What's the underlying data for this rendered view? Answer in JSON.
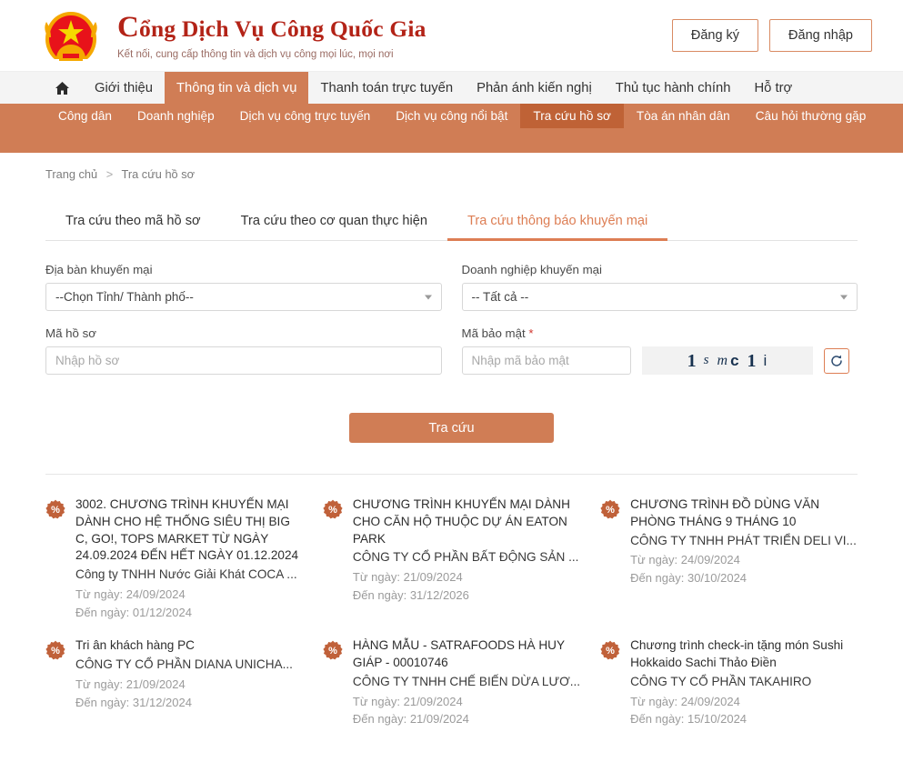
{
  "header": {
    "emblem_icon": "vietnam-national-emblem",
    "title_line": "Cổng Dịch Vụ Công Quốc Gia",
    "title_cap": "C",
    "title_rest": "ổng Dịch Vụ Công Quốc Gia",
    "subtitle": "Kết nối, cung cấp thông tin và dịch vụ công mọi lúc, mọi nơi",
    "register_label": "Đăng ký",
    "login_label": "Đăng nhập"
  },
  "nav": {
    "home_icon": "home-icon",
    "top_items": [
      {
        "label": "Giới thiệu",
        "active": false
      },
      {
        "label": "Thông tin và dịch vụ",
        "active": true
      },
      {
        "label": "Thanh toán trực tuyến",
        "active": false
      },
      {
        "label": "Phản ánh kiến nghị",
        "active": false
      },
      {
        "label": "Thủ tục hành chính",
        "active": false
      },
      {
        "label": "Hỗ trợ",
        "active": false
      }
    ],
    "sub_items": [
      {
        "label": "Công dân",
        "active": false
      },
      {
        "label": "Doanh nghiệp",
        "active": false
      },
      {
        "label": "Dịch vụ công trực tuyến",
        "active": false
      },
      {
        "label": "Dịch vụ công nổi bật",
        "active": false
      },
      {
        "label": "Tra cứu hồ sơ",
        "active": true
      },
      {
        "label": "Tòa án nhân dân",
        "active": false
      },
      {
        "label": "Câu hỏi thường gặp",
        "active": false
      }
    ]
  },
  "breadcrumb": {
    "home": "Trang chủ",
    "separator": ">",
    "current": "Tra cứu hồ sơ"
  },
  "tabs": [
    {
      "label": "Tra cứu theo mã hồ sơ",
      "active": false
    },
    {
      "label": "Tra cứu theo cơ quan thực hiện",
      "active": false
    },
    {
      "label": "Tra cứu thông báo khuyến mại",
      "active": true
    }
  ],
  "form": {
    "province": {
      "label": "Địa bàn khuyến mại",
      "value": "--Chọn Tỉnh/ Thành phố--"
    },
    "enterprise": {
      "label": "Doanh nghiệp khuyến mại",
      "value": "-- Tất cả --"
    },
    "dossier_code": {
      "label": "Mã hồ sơ",
      "value": "",
      "placeholder": "Nhập hồ sơ"
    },
    "captcha": {
      "label": "Mã bảo mật",
      "required_mark": "*",
      "value": "",
      "placeholder": "Nhập mã bảo mật",
      "code_chars": [
        "1",
        "s",
        "m",
        "c",
        "1",
        "i"
      ],
      "code_text": "1 s mc 1 i",
      "refresh_icon": "refresh-icon"
    },
    "submit_label": "Tra cứu"
  },
  "results": {
    "badge_icon": "percent-badge-icon",
    "from_label": "Từ ngày:",
    "to_label": "Đến ngày:",
    "items": [
      {
        "title": "3002. CHƯƠNG TRÌNH KHUYẾN MẠI DÀNH CHO HỆ THỐNG SIÊU THỊ BIG C, GO!, TOPS MARKET TỪ NGÀY 24.09.2024 ĐẾN HẾT NGÀY 01.12.2024",
        "org": "Công ty TNHH Nước Giải Khát COCA ...",
        "from_date": "24/09/2024",
        "to_date": "01/12/2024"
      },
      {
        "title": "CHƯƠNG TRÌNH KHUYẾN MẠI DÀNH CHO CĂN HỘ THUỘC DỰ ÁN EATON PARK",
        "org": "CÔNG TY CỔ PHẦN BẤT ĐỘNG SẢN ...",
        "from_date": "21/09/2024",
        "to_date": "31/12/2026"
      },
      {
        "title": "CHƯƠNG TRÌNH ĐỒ DÙNG VĂN PHÒNG THÁNG 9 THÁNG 10",
        "org": "CÔNG TY TNHH PHÁT TRIỂN DELI VI...",
        "from_date": "24/09/2024",
        "to_date": "30/10/2024"
      },
      {
        "title": "Tri ân khách hàng PC",
        "org": "CÔNG TY CỔ PHẦN DIANA UNICHA...",
        "from_date": "21/09/2024",
        "to_date": "31/12/2024"
      },
      {
        "title": "HÀNG MẪU - SATRAFOODS HÀ HUY GIÁP - 00010746",
        "org": "CÔNG TY TNHH CHẾ BIẾN DỪA LƯƠ...",
        "from_date": "21/09/2024",
        "to_date": "21/09/2024"
      },
      {
        "title": "Chương trình check-in tặng món Sushi Hokkaido Sachi Thảo Điền",
        "org": "CÔNG TY CỔ PHẦN TAKAHIRO",
        "from_date": "24/09/2024",
        "to_date": "15/10/2024"
      }
    ]
  },
  "colors": {
    "brand_red": "#b32317",
    "accent_orange": "#d07d55",
    "accent_orange_dark": "#bf6236",
    "tab_active": "#dd7e54",
    "muted_text": "#9b9b9b"
  }
}
